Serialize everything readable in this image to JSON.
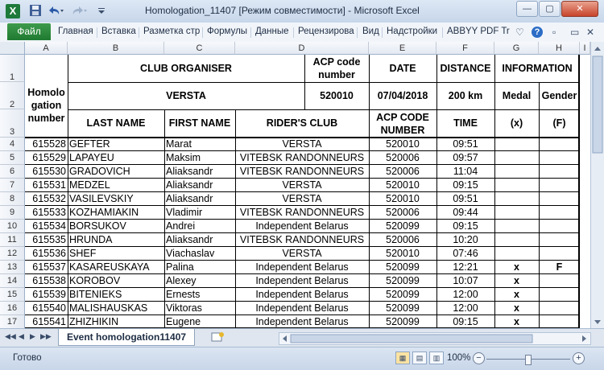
{
  "window": {
    "title": "Homologation_11407  [Режим совместимости]  -  Microsoft Excel",
    "app_icon": "X",
    "qat_icons": [
      "save-icon",
      "undo-icon",
      "redo-icon",
      "customize-icon"
    ],
    "controls": [
      "minimize",
      "maximize",
      "close"
    ],
    "control_glyphs": {
      "minimize": "—",
      "maximize": "▢",
      "close": "✕"
    }
  },
  "ribbon": {
    "file_label": "Файл",
    "tabs": [
      "Главная",
      "Вставка",
      "Разметка стр",
      "Формулы",
      "Данные",
      "Рецензирова",
      "Вид",
      "Надстройки",
      "ABBYY PDF Tr"
    ],
    "right_icons": [
      "minimize-ribbon-icon",
      "help-icon",
      "restore-icon",
      "close-doc-icon"
    ],
    "right_glyphs": [
      "♡",
      "?",
      "▫",
      "✕"
    ]
  },
  "columns": [
    "A",
    "B",
    "C",
    "D",
    "E",
    "F",
    "G",
    "H",
    "I"
  ],
  "rows": [
    "1",
    "2",
    "3",
    "4",
    "5",
    "6",
    "7",
    "8",
    "9",
    "10",
    "11",
    "12",
    "13",
    "14",
    "15",
    "16",
    "17"
  ],
  "sheet": {
    "homologation_header": "Homolo gation number",
    "club_organiser_label": "CLUB ORGANISER",
    "acp_code_label": "ACP code number",
    "date_label": "DATE",
    "distance_label": "DISTANCE",
    "information_label": "INFORMATION",
    "club_organiser_value": "VERSTA",
    "acp_code_value": "520010",
    "date_value": "07/04/2018",
    "distance_value": "200 km",
    "medal_label": "Medal",
    "gender_label": "Gender",
    "col_headers": {
      "last_name": "LAST NAME",
      "first_name": "FIRST NAME",
      "riders_club": "RIDER'S CLUB",
      "acp_code": "ACP CODE NUMBER",
      "time": "TIME",
      "medal": "(x)",
      "gender": "(F)"
    },
    "riders": [
      {
        "number": "615528",
        "last_name": "GEFTER",
        "first_name": "Marat",
        "club": "VERSTA",
        "acp_code": "520010",
        "time": "09:51",
        "medal": "",
        "gender": ""
      },
      {
        "number": "615529",
        "last_name": "LAPAYEU",
        "first_name": "Maksim",
        "club": "VITEBSK RANDONNEURS",
        "acp_code": "520006",
        "time": "09:57",
        "medal": "",
        "gender": ""
      },
      {
        "number": "615530",
        "last_name": "GRADOVICH",
        "first_name": "Aliaksandr",
        "club": "VITEBSK RANDONNEURS",
        "acp_code": "520006",
        "time": "11:04",
        "medal": "",
        "gender": ""
      },
      {
        "number": "615531",
        "last_name": "MEDZEL",
        "first_name": "Aliaksandr",
        "club": "VERSTA",
        "acp_code": "520010",
        "time": "09:15",
        "medal": "",
        "gender": ""
      },
      {
        "number": "615532",
        "last_name": "VASILEVSKIY",
        "first_name": "Aliaksandr",
        "club": "VERSTA",
        "acp_code": "520010",
        "time": "09:51",
        "medal": "",
        "gender": ""
      },
      {
        "number": "615533",
        "last_name": "KOZHAMIAKIN",
        "first_name": "Vladimir",
        "club": "VITEBSK RANDONNEURS",
        "acp_code": "520006",
        "time": "09:44",
        "medal": "",
        "gender": ""
      },
      {
        "number": "615534",
        "last_name": "BORSUKOV",
        "first_name": "Andrei",
        "club": "Independent Belarus",
        "acp_code": "520099",
        "time": "09:15",
        "medal": "",
        "gender": ""
      },
      {
        "number": "615535",
        "last_name": "HRUNDA",
        "first_name": "Aliaksandr",
        "club": "VITEBSK RANDONNEURS",
        "acp_code": "520006",
        "time": "10:20",
        "medal": "",
        "gender": ""
      },
      {
        "number": "615536",
        "last_name": "SHEF",
        "first_name": "Viachaslav",
        "club": "VERSTA",
        "acp_code": "520010",
        "time": "07:46",
        "medal": "",
        "gender": ""
      },
      {
        "number": "615537",
        "last_name": "KASAREUSKAYA",
        "first_name": "Palina",
        "club": "Independent Belarus",
        "acp_code": "520099",
        "time": "12:21",
        "medal": "x",
        "gender": "F"
      },
      {
        "number": "615538",
        "last_name": "KOROBOV",
        "first_name": "Alexey",
        "club": "Independent Belarus",
        "acp_code": "520099",
        "time": "10:07",
        "medal": "x",
        "gender": ""
      },
      {
        "number": "615539",
        "last_name": "BITENIEKS",
        "first_name": "Ernests",
        "club": "Independent Belarus",
        "acp_code": "520099",
        "time": "12:00",
        "medal": "x",
        "gender": ""
      },
      {
        "number": "615540",
        "last_name": "MALISHAUSKAS",
        "first_name": "Viktoras",
        "club": "Independent Belarus",
        "acp_code": "520099",
        "time": "12:00",
        "medal": "x",
        "gender": ""
      },
      {
        "number": "615541",
        "last_name": "ZHIZHIKIN",
        "first_name": "Eugene",
        "club": "Independent Belarus",
        "acp_code": "520099",
        "time": "09:15",
        "medal": "x",
        "gender": ""
      }
    ]
  },
  "sheet_tabs": {
    "active": "Event homologation11407",
    "nav_glyphs": [
      "◀◀",
      "◀",
      "▶",
      "▶▶"
    ],
    "new_sheet_icon": "insert-sheet-icon"
  },
  "status": {
    "ready": "Готово",
    "zoom": "100%",
    "zoom_fraction": 0.5,
    "zoom_minus": "−",
    "zoom_plus": "+",
    "view_glyphs": [
      "▦",
      "▤",
      "▥"
    ]
  }
}
